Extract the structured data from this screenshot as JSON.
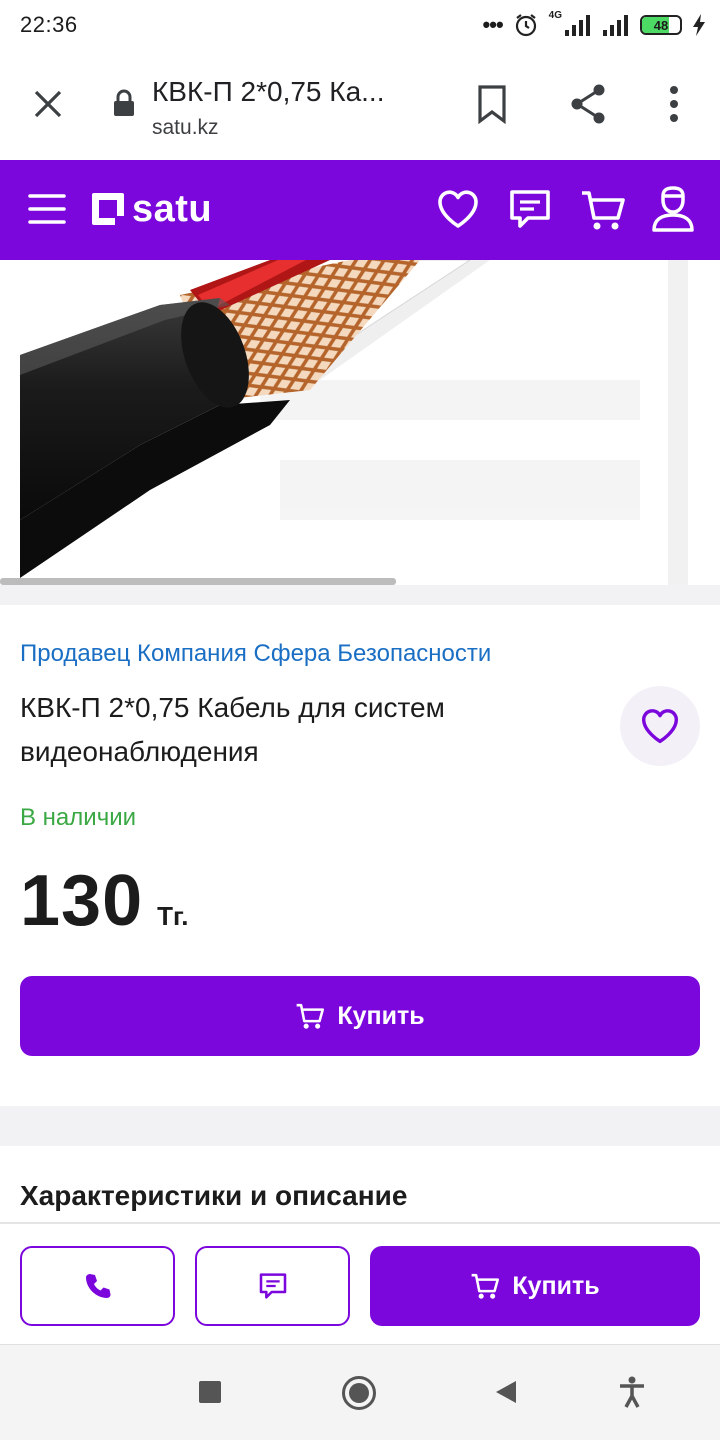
{
  "status_bar": {
    "time": "22:36",
    "network": "4G",
    "battery": "48"
  },
  "browser": {
    "page_title": "КВК-П 2*0,75 Ка...",
    "host": "satu.kz"
  },
  "app_header": {
    "logo_text": "satu",
    "brand_color": "#7b07dc"
  },
  "product": {
    "seller": "Продавец Компания Сфера Безопасности",
    "title": "КВК-П 2*0,75 Кабель для систем видеонаблюдения",
    "availability": "В наличии",
    "price": "130",
    "currency": "Тг.",
    "buy_label": "Купить",
    "availability_color": "#3aa843",
    "seller_link_color": "#1a6fc4"
  },
  "section": {
    "title": "Характеристики и описание"
  },
  "action_bar": {
    "buy_label": "Купить"
  },
  "icons": {
    "close": "close-icon",
    "lock": "lock-icon",
    "bookmark": "bookmark-icon",
    "share": "share-icon",
    "more": "more-vert-icon",
    "menu": "hamburger-menu-icon",
    "favorites": "heart-icon",
    "messages": "chat-icon",
    "cart": "cart-icon",
    "profile": "user-icon",
    "phone": "phone-icon"
  }
}
